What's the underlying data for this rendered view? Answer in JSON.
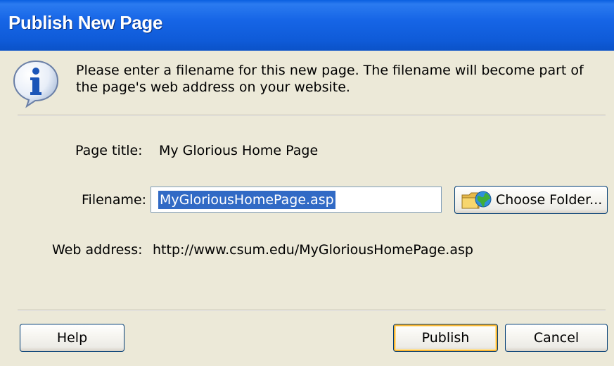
{
  "window": {
    "title": "Publish New Page"
  },
  "info": {
    "icon": "info-icon",
    "message": "Please enter a filename for this new page. The filename will become part of the page's web address on your website."
  },
  "form": {
    "page_title_label": "Page title:",
    "page_title_value": "My Glorious Home Page",
    "filename_label": "Filename:",
    "filename_value": "MyGloriousHomePage.asp",
    "choose_folder_label": "Choose Folder...",
    "choose_folder_icon": "folder-globe-icon",
    "web_address_label": "Web address:",
    "web_address_value": "http://www.csum.edu/MyGloriousHomePage.asp"
  },
  "buttons": {
    "help": "Help",
    "publish": "Publish",
    "cancel": "Cancel"
  },
  "colors": {
    "titlebar": "#0f5bd8",
    "dialog_bg": "#ece9d8",
    "selection": "#316ac5",
    "default_button_highlight": "#f8b636"
  }
}
